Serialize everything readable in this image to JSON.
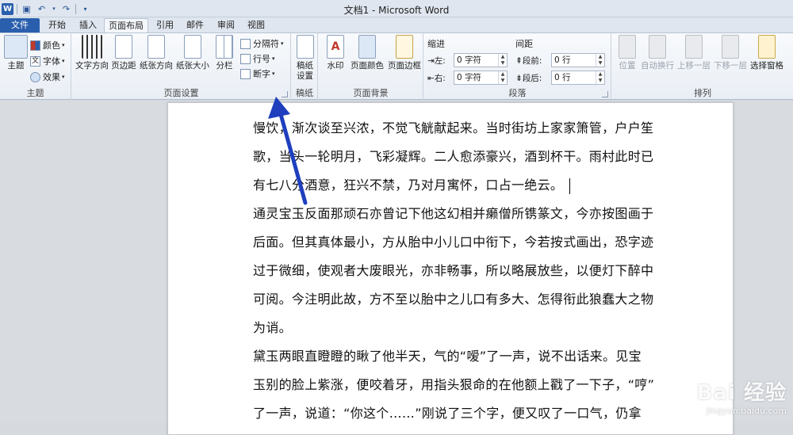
{
  "window": {
    "title": "文档1 - Microsoft Word"
  },
  "tabs": [
    "文件",
    "开始",
    "插入",
    "页面布局",
    "引用",
    "邮件",
    "审阅",
    "视图"
  ],
  "ribbon": {
    "theme_group": {
      "label": "主题",
      "theme_button": "主题",
      "colors": "颜色",
      "fonts": "字体",
      "effects": "效果"
    },
    "page_setup_group": {
      "label": "页面设置",
      "text_direction": "文字方向",
      "margins": "页边距",
      "orientation": "纸张方向",
      "size": "纸张大小",
      "columns": "分栏",
      "breaks": "分隔符",
      "line_numbers": "行号",
      "hyphenation": "断字"
    },
    "draft_group": {
      "label": "稿纸",
      "draft_settings_line1": "稿纸",
      "draft_settings_line2": "设置"
    },
    "page_background_group": {
      "label": "页面背景",
      "watermark": "水印",
      "page_color": "页面颜色",
      "page_borders": "页面边框"
    },
    "paragraph_group": {
      "label": "段落",
      "indent": "缩进",
      "spacing": "间距",
      "left_label": "左:",
      "right_label": "右:",
      "before_label": "段前:",
      "after_label": "段后:",
      "left_value": "0 字符",
      "right_value": "0 字符",
      "before_value": "0 行",
      "after_value": "0 行"
    },
    "arrange_group": {
      "label": "排列",
      "position": "位置",
      "wrap_text": "自动换行",
      "bring_forward": "上移一层",
      "send_backward": "下移一层",
      "selection_pane": "选择窗格"
    }
  },
  "document": {
    "lines": [
      "慢饮，渐次谈至兴浓，不觉飞觥献起来。当时街坊上家家箫管，户户笙",
      "歌，当头一轮明月，飞彩凝辉。二人愈添豪兴，酒到杯干。雨村此时已",
      "有七八分酒意，狂兴不禁，乃对月寓怀，口占一绝云。",
      "通灵宝玉反面那顽石亦曾记下他这幻相并癞僧所镌篆文，今亦按图画于",
      "后面。但其真体最小，方从胎中小儿口中衔下，今若按式画出，恐字迹",
      "过于微细，使观者大废眼光，亦非畅事，所以略展放些，以便灯下醉中",
      "可阅。今注明此故，方不至以胎中之儿口有多大、怎得衔此狼蠢大之物",
      "为诮。",
      "黛玉两眼直瞪瞪的瞅了他半天，气的“嗳”了一声，说不出话来。见宝",
      "玉别的脸上紫涨，便咬着牙，用指头狠命的在他额上戳了一下子，“哼”",
      "了一声，说道：“你这个……”刚说了三个字，便又叹了一口气，仍拿"
    ]
  },
  "watermark": {
    "logo": "Bai 经验",
    "sub": "jingyan.baidu.com"
  },
  "annotation": {
    "color": "#1f3fbf"
  }
}
